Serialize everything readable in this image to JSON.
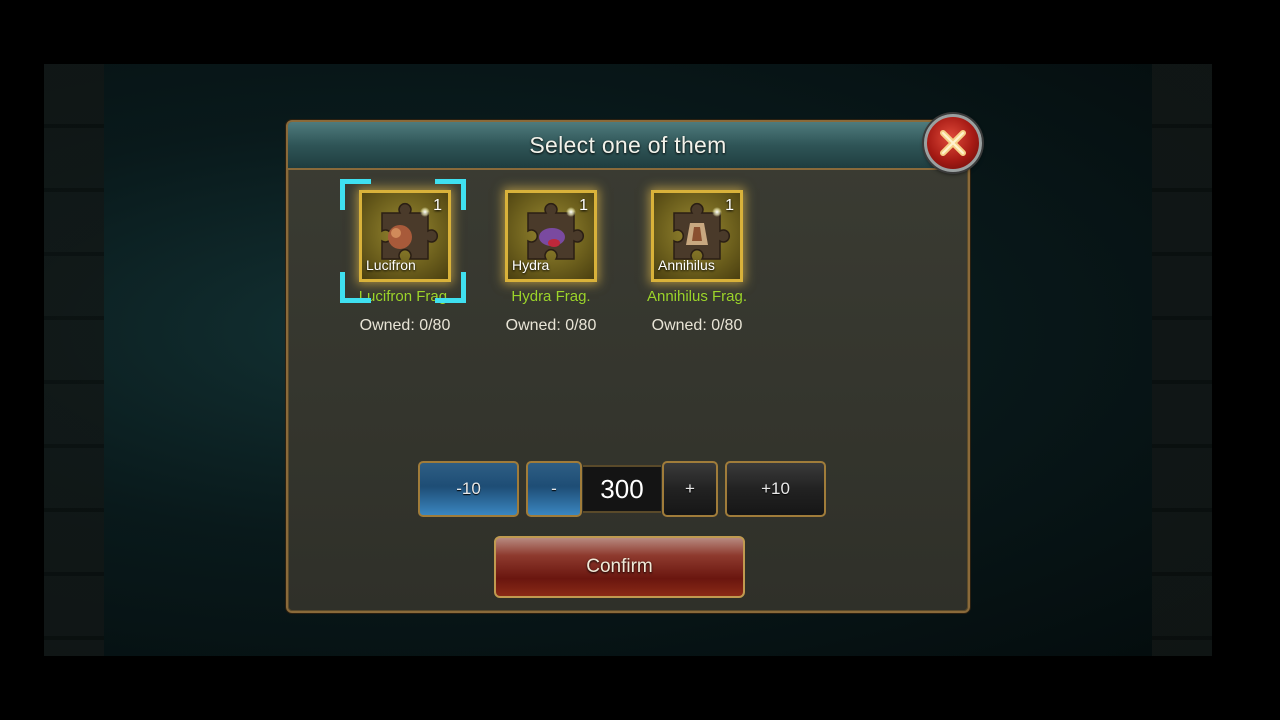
{
  "dialog": {
    "title": "Select one of them",
    "close_icon": "close-x-icon"
  },
  "items": [
    {
      "name": "Lucifron",
      "count": "1",
      "fragment": "Lucifron Frag.",
      "owned": "Owned: 0/80",
      "selected": true
    },
    {
      "name": "Hydra",
      "count": "1",
      "fragment": "Hydra Frag.",
      "owned": "Owned: 0/80",
      "selected": false
    },
    {
      "name": "Annihilus",
      "count": "1",
      "fragment": "Annihilus Frag.",
      "owned": "Owned: 0/80",
      "selected": false
    }
  ],
  "quantity": {
    "minus10": "-10",
    "minus1": "-",
    "value": "300",
    "plus1": "+",
    "plus10": "+10"
  },
  "confirm_label": "Confirm",
  "colors": {
    "frag_green": "#9bd42a",
    "selector_cyan": "#3fe0f0",
    "title_teal": "#2f5557",
    "confirm_red": "#6a160f"
  }
}
